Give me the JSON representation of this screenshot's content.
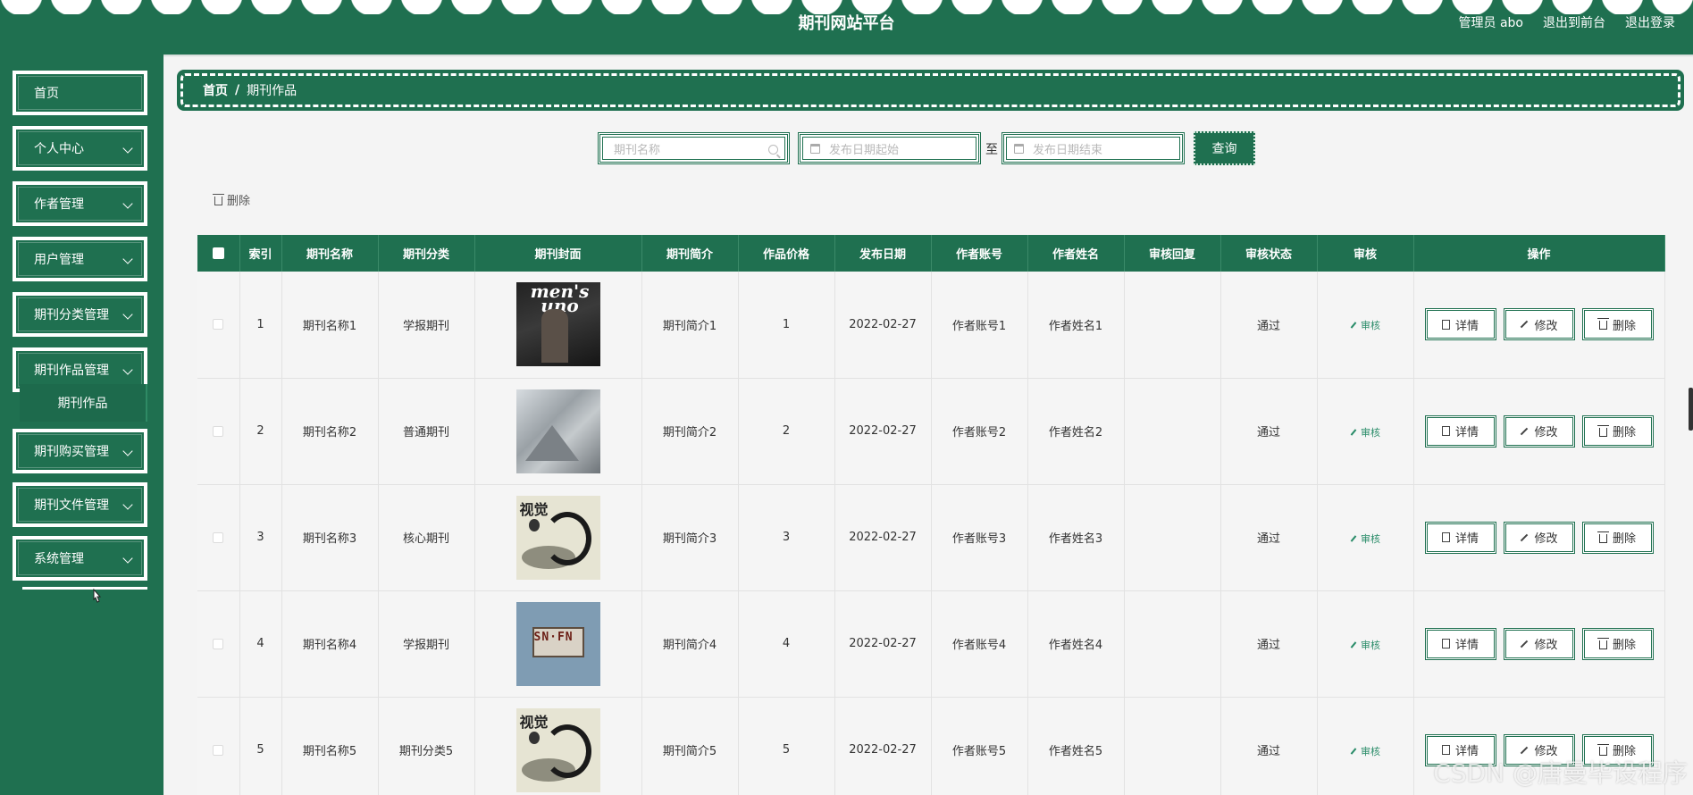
{
  "header": {
    "title": "期刊网站平台",
    "admin_label": "管理员 abo",
    "to_front_label": "退出到前台",
    "logout_label": "退出登录"
  },
  "sidebar": {
    "items": [
      {
        "label": "首页",
        "has_arrow": false
      },
      {
        "label": "个人中心",
        "has_arrow": true
      },
      {
        "label": "作者管理",
        "has_arrow": true
      },
      {
        "label": "用户管理",
        "has_arrow": true
      },
      {
        "label": "期刊分类管理",
        "has_arrow": true
      },
      {
        "label": "期刊作品管理",
        "has_arrow": true
      }
    ],
    "submenu_item": "期刊作品",
    "items_after": [
      {
        "label": "期刊购买管理",
        "has_arrow": true
      },
      {
        "label": "期刊文件管理",
        "has_arrow": true
      },
      {
        "label": "系统管理",
        "has_arrow": true
      }
    ]
  },
  "breadcrumb": {
    "home": "首页",
    "separator": "/",
    "current": "期刊作品"
  },
  "search": {
    "name_placeholder": "期刊名称",
    "date_start_placeholder": "发布日期起始",
    "to_label": "至",
    "date_end_placeholder": "发布日期结束",
    "query_button": "查询"
  },
  "toolbar": {
    "delete_label": "删除"
  },
  "table": {
    "columns": [
      "索引",
      "期刊名称",
      "期刊分类",
      "期刊封面",
      "期刊简介",
      "作品价格",
      "发布日期",
      "作者账号",
      "作者姓名",
      "审核回复",
      "审核状态",
      "审核",
      "操作"
    ],
    "audit_link": "审核",
    "detail_button": "详情",
    "edit_button": "修改",
    "delete_button": "删除",
    "rows": [
      {
        "index": "1",
        "name": "期刊名称1",
        "category": "学报期刊",
        "cover": "dark",
        "cover_text": "men's uno",
        "intro": "期刊简介1",
        "price": "1",
        "date": "2022-02-27",
        "account": "作者账号1",
        "author": "作者姓名1",
        "reply": "",
        "status": "通过"
      },
      {
        "index": "2",
        "name": "期刊名称2",
        "category": "普通期刊",
        "cover": "gray",
        "cover_text": "",
        "intro": "期刊简介2",
        "price": "2",
        "date": "2022-02-27",
        "account": "作者账号2",
        "author": "作者姓名2",
        "reply": "",
        "status": "通过"
      },
      {
        "index": "3",
        "name": "期刊名称3",
        "category": "核心期刊",
        "cover": "art",
        "cover_text": "视觉",
        "intro": "期刊简介3",
        "price": "3",
        "date": "2022-02-27",
        "account": "作者账号3",
        "author": "作者姓名3",
        "reply": "",
        "status": "通过"
      },
      {
        "index": "4",
        "name": "期刊名称4",
        "category": "学报期刊",
        "cover": "blue",
        "cover_text": "SN·FN",
        "intro": "期刊简介4",
        "price": "4",
        "date": "2022-02-27",
        "account": "作者账号4",
        "author": "作者姓名4",
        "reply": "",
        "status": "通过"
      },
      {
        "index": "5",
        "name": "期刊名称5",
        "category": "期刊分类5",
        "cover": "art",
        "cover_text": "视觉",
        "intro": "期刊简介5",
        "price": "5",
        "date": "2022-02-27",
        "account": "作者账号5",
        "author": "作者姓名5",
        "reply": "",
        "status": "通过"
      }
    ]
  },
  "watermark": "CSDN @唐曼毕设程序",
  "colors": {
    "primary": "#1f7050",
    "audit_link": "#2a8c69",
    "background": "#f4f4f4"
  }
}
